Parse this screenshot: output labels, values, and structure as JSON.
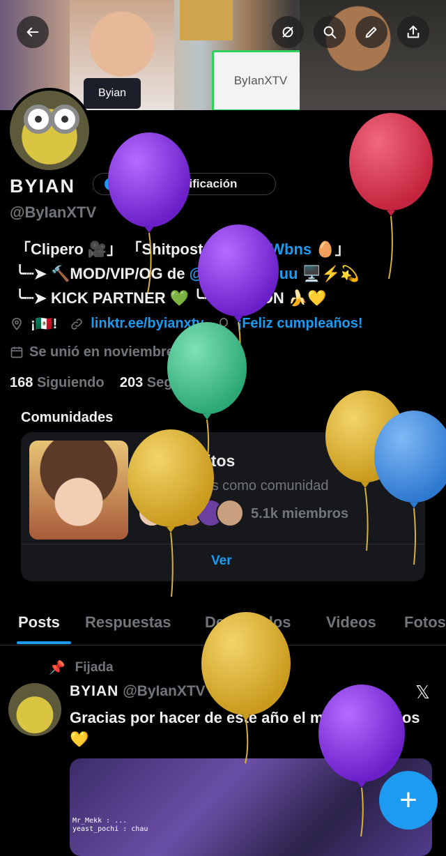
{
  "header": {
    "banner_card_text": "Byian",
    "whiteboard_text": "ByIanXTV"
  },
  "profile": {
    "display_name": "BYIAN",
    "verify_button": "Obtener verificación",
    "handle": "@ByIanXTV",
    "bio": [
      "「Clipero 🎥」 「Shitpost 🎭」 「#Wbns 🥚」",
      "╰┈➤ 🔨MOD/VIP/OG de @Soaringchuu 🖥️⚡💫",
      "╰┈➤ KICK PARTNER 💚 ╰┈➤ MINION 🍌💛"
    ],
    "bio_hashtag": "#Wbns",
    "bio_mention": "@Soaringchuu",
    "location": "¡🇲🇽!",
    "website": "linktr.ee/byianxtv",
    "birthday": "¡Feliz cumpleaños!",
    "joined": "Se unió en noviembre de 2023",
    "following_count": "168",
    "following_label": "Siguiendo",
    "followers_count": "203",
    "followers_label": "Seguidores"
  },
  "communities": {
    "title": "Comunidades",
    "name": "Soaringcitos",
    "description": "Convivir mas como comunidad",
    "members": "5.1k miembros",
    "see_label": "Ver"
  },
  "tabs": [
    "Posts",
    "Respuestas",
    "Destacados",
    "Videos",
    "Fotos"
  ],
  "post": {
    "pinned_label": "Fijada",
    "author": "BYIAN",
    "handle_date": "@ByIanXTV · 30/12/25",
    "text": "Gracias por hacer de este año el mejor de todos 💛",
    "media_overlay": "Mr_Mekk : ...\nyeast_pochi : chau"
  },
  "colors": {
    "accent": "#1d9bf0",
    "background": "#000000",
    "muted": "#71767b",
    "balloon_purple": "#8a2be2",
    "balloon_red": "#d5344f",
    "balloon_green": "#3cc38a",
    "balloon_yellow": "#e0b72e",
    "balloon_blue": "#3d8fe0"
  },
  "icons": [
    "back-arrow-icon",
    "no-sync-icon",
    "search-icon",
    "edit-pencil-icon",
    "share-icon",
    "location-pin-icon",
    "link-icon",
    "balloon-icon",
    "calendar-icon",
    "chevron-right-icon",
    "pin-icon",
    "x-logo-icon",
    "plus-icon"
  ]
}
